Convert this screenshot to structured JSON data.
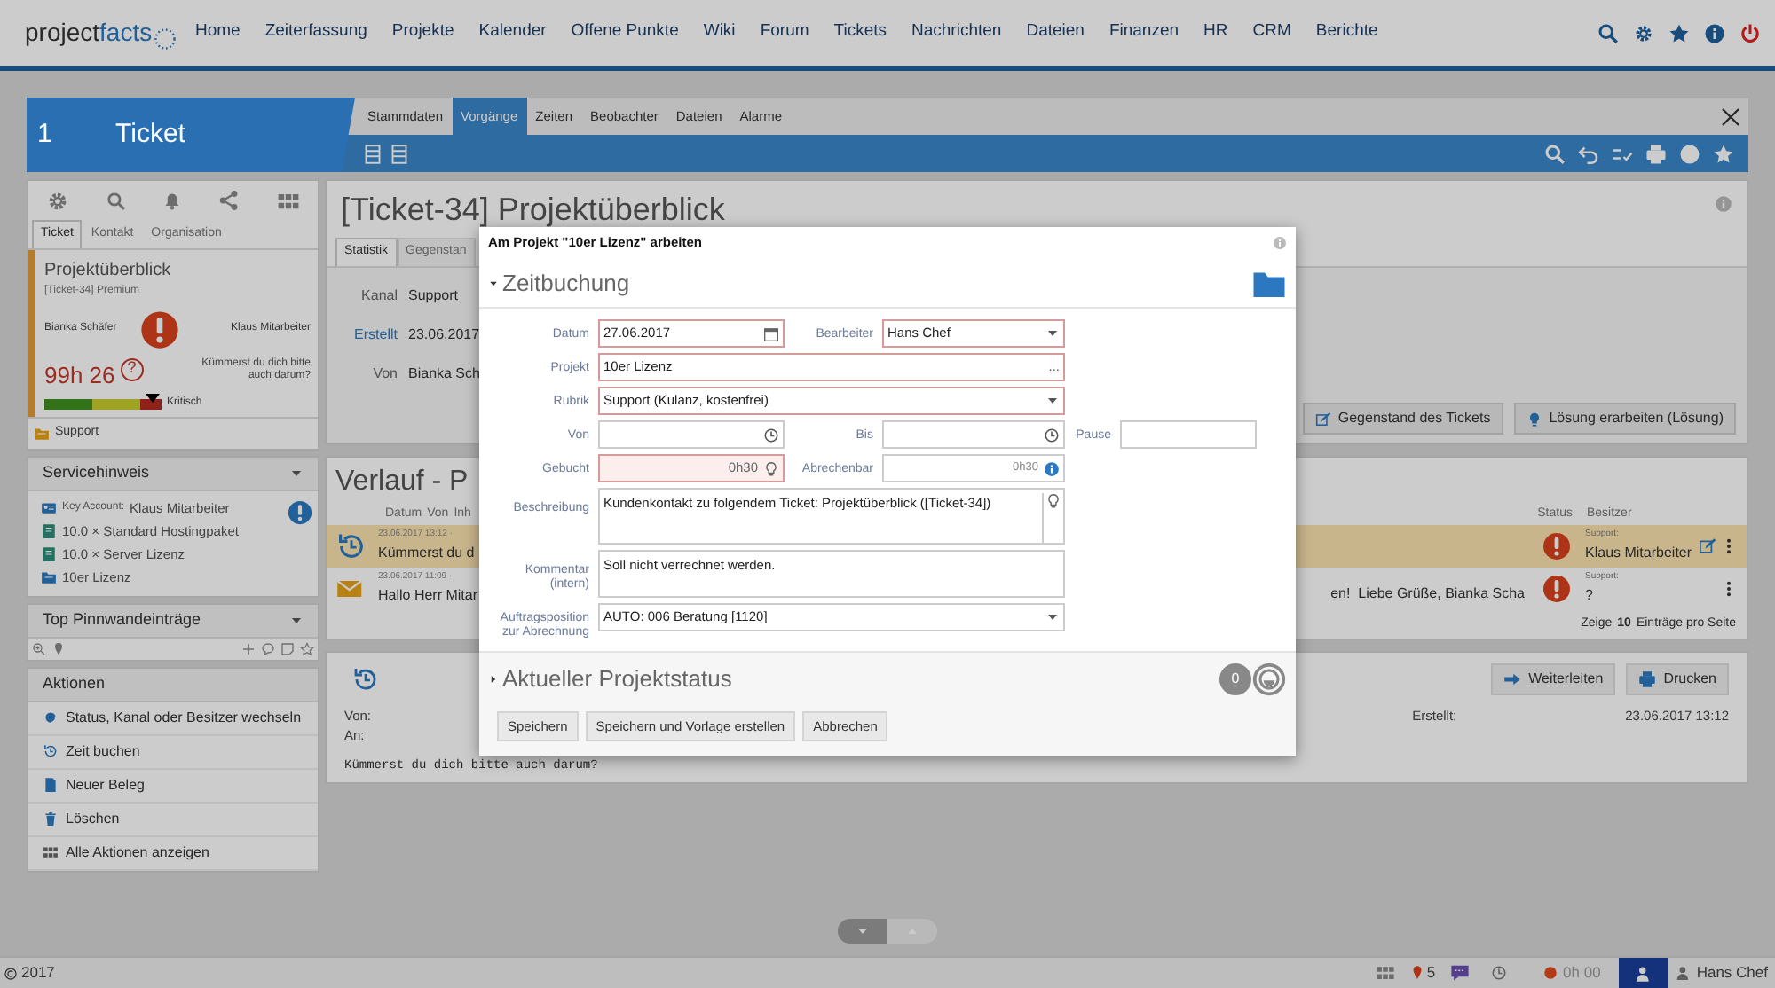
{
  "nav": {
    "logo_main": "project",
    "logo_accent": "facts",
    "items": [
      "Home",
      "Zeiterfassung",
      "Projekte",
      "Kalender",
      "Offene Punkte",
      "Wiki",
      "Forum",
      "Tickets",
      "Nachrichten",
      "Dateien",
      "Finanzen",
      "HR",
      "CRM",
      "Berichte"
    ]
  },
  "ticket": {
    "number": "1",
    "title": "Ticket",
    "tabs": [
      {
        "label": "Stammdaten",
        "selected": false
      },
      {
        "label": "Vorgänge",
        "selected": true
      },
      {
        "label": "Zeiten",
        "selected": false
      },
      {
        "label": "Beobachter",
        "selected": false
      },
      {
        "label": "Dateien",
        "selected": false
      },
      {
        "label": "Alarme",
        "selected": false
      }
    ]
  },
  "left": {
    "tabs": [
      {
        "label": "Ticket",
        "selected": true
      },
      {
        "label": "Kontakt",
        "selected": false
      },
      {
        "label": "Organisation",
        "selected": false
      }
    ],
    "card": {
      "title": "Projektüberblick",
      "subtitle": "[Ticket-34] Premium",
      "from": "Bianka Schäfer",
      "to": "Klaus Mitarbeiter",
      "time": "99h 26",
      "help": "?",
      "message": "Kümmerst du dich bitte auch darum?",
      "priority": "Kritisch",
      "level": 0.92,
      "channel": "Support"
    },
    "service": {
      "title": "Servicehinweis",
      "items": [
        {
          "kind": "contact",
          "label": "Key Account:",
          "text": "Klaus Mitarbeiter"
        },
        {
          "kind": "product",
          "text": "10.0 × Standard Hostingpaket"
        },
        {
          "kind": "product",
          "text": "10.0 × Server Lizenz"
        },
        {
          "kind": "project",
          "text": "10er Lizenz"
        }
      ]
    },
    "pinboard": {
      "title": "Top Pinnwandeinträge"
    },
    "actions": {
      "title": "Aktionen",
      "items": [
        {
          "kind": "status",
          "label": "Status, Kanal oder Besitzer wechseln"
        },
        {
          "kind": "time",
          "label": "Zeit buchen"
        },
        {
          "kind": "document",
          "label": "Neuer Beleg"
        },
        {
          "kind": "delete",
          "label": "Löschen"
        },
        {
          "kind": "all",
          "label": "Alle Aktionen anzeigen"
        }
      ]
    }
  },
  "main": {
    "heading": "[Ticket-34] Projektüberblick",
    "tabs": [
      {
        "label": "Statistik",
        "selected": true
      },
      {
        "label": "Gegenstan",
        "selected": false
      }
    ],
    "fields": [
      {
        "label": "Kanal",
        "value": "Support",
        "link": false
      },
      {
        "label": "Erstellt",
        "value": "23.06.2017",
        "link": true
      },
      {
        "label": "Von",
        "value": "Bianka Sch",
        "link": false
      }
    ],
    "buttons": [
      {
        "kind": "edit",
        "label": "Gegenstand des Tickets"
      },
      {
        "kind": "bulb",
        "label": "Lösung erarbeiten (Lösung)"
      }
    ],
    "history": {
      "title": "Verlauf - P",
      "columns": [
        "Datum",
        "Von",
        "Inh"
      ],
      "status_column": "Status",
      "owner_column": "Besitzer",
      "rows": [
        {
          "kind": "task",
          "meta": "23.06.2017 13:12 ·",
          "text": "Kümmerst du d",
          "tail": "",
          "selected": true,
          "owner_label": "Support:",
          "owner": "Klaus Mitarbeiter",
          "editable": true
        },
        {
          "kind": "mail",
          "meta": "23.06.2017 11:09 ·",
          "text": "Hallo Herr Mitar",
          "tail": "en!  Liebe Grüße, Bianka Scha",
          "selected": false,
          "owner_label": "Support:",
          "owner": "?",
          "editable": false
        }
      ],
      "footer": {
        "prefix": "Zeige",
        "count": "10",
        "suffix": "Einträge pro Seite"
      }
    },
    "detail": {
      "buttons": [
        {
          "kind": "forward",
          "label": "Weiterleiten"
        },
        {
          "kind": "print",
          "label": "Drucken"
        }
      ],
      "from_label": "Von:",
      "to_label": "An:",
      "created_label": "Erstellt:",
      "created": "23.06.2017 13:12",
      "body": "Kümmerst du dich bitte auch darum?"
    }
  },
  "modal": {
    "title": "Am Projekt \"10er Lizenz\" arbeiten",
    "section": "Zeitbuchung",
    "rows": [
      [
        {
          "label": "Datum",
          "value": "27.06.2017",
          "kind": "date",
          "required": true
        },
        {
          "label": "Bearbeiter",
          "value": "Hans Chef",
          "kind": "select",
          "required": true
        }
      ],
      [
        {
          "label": "Projekt",
          "value": "10er Lizenz",
          "kind": "picker",
          "suffix": "...",
          "required": true
        }
      ],
      [
        {
          "label": "Rubrik",
          "value": "Support (Kulanz, kostenfrei)",
          "kind": "select",
          "required": true
        }
      ],
      [
        {
          "label": "Von",
          "kind": "time",
          "required": false
        },
        {
          "label": "Bis",
          "kind": "time",
          "required": false
        },
        {
          "label": "Pause",
          "kind": "text",
          "required": false
        }
      ],
      [
        {
          "label": "Gebucht",
          "value": "0h30",
          "kind": "hours",
          "required": true
        },
        {
          "label": "Abrechenbar",
          "value": "0h30",
          "kind": "billable",
          "required": false
        }
      ],
      [
        {
          "label": "Beschreibung",
          "value": "Kundenkontakt zu folgendem Ticket: Projektüberblick ([Ticket-34])",
          "kind": "textarea",
          "required": false
        }
      ],
      [
        {
          "label": "Kommentar (intern)",
          "value": "Soll nicht verrechnet werden.",
          "kind": "textarea",
          "required": false
        }
      ],
      [
        {
          "label": "Auftragsposition zur Abrechnung",
          "value": "AUTO: 006 Beratung [1120]",
          "kind": "select",
          "required": false
        }
      ]
    ],
    "status_section": "Aktueller Projektstatus",
    "status_count": "0",
    "buttons": [
      "Speichern",
      "Speichern und Vorlage erstellen",
      "Abbrechen"
    ]
  },
  "status_bar": {
    "year": "2017",
    "notifications": "5",
    "timer": "0h 00",
    "user": "Hans Chef"
  }
}
